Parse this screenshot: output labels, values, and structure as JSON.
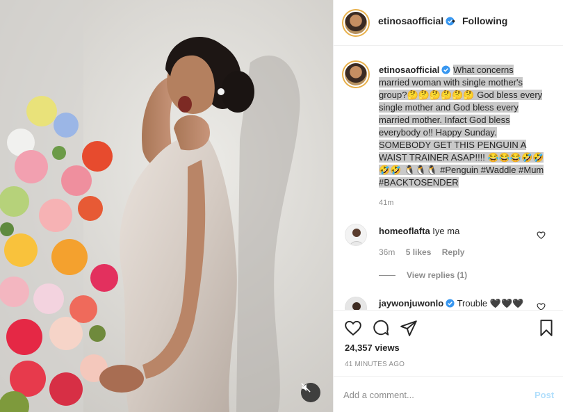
{
  "post": {
    "username": "etinosaofficial",
    "dot": "•",
    "follow_status": "Following"
  },
  "caption": {
    "username": "etinosaofficial",
    "text": "What concerns married woman with single mother's group?🤔🤔🤔🤔🤔🤔 God bless every single mother and God bless every married mother. Infact God bless everybody o!! Happy Sunday. SOMEBODY GET THIS PENGUIN A WAIST TRAINER ASAP!!!! 😂😂😂🤣🤣🤣🤣 🐧🐧🐧 #Penguin #Waddle #Mum #BACKTOSENDER",
    "time": "41m"
  },
  "comments": [
    {
      "username": "homeoflafta",
      "text": "Iye ma",
      "time": "36m",
      "likes": "5 likes",
      "reply": "Reply",
      "view_replies": "View replies (1)"
    },
    {
      "username": "jaywonjuwonlo",
      "text": "Trouble 🖤🖤🖤"
    }
  ],
  "stats": {
    "views": "24,357 views",
    "posted": "41 MINUTES AGO"
  },
  "add_comment": {
    "placeholder": "Add a comment...",
    "post_label": "Post"
  },
  "icons": {
    "like": "heart-icon",
    "comment": "comment-icon",
    "share": "share-icon",
    "save": "bookmark-icon",
    "mute": "mute-icon",
    "verified": "verified-badge-icon"
  },
  "colors": {
    "verified_blue": "#3897f0",
    "post_disabled": "#b2dffc",
    "caption_highlight": "#c9c9c9",
    "avatar_ring": "#e8b04a"
  }
}
